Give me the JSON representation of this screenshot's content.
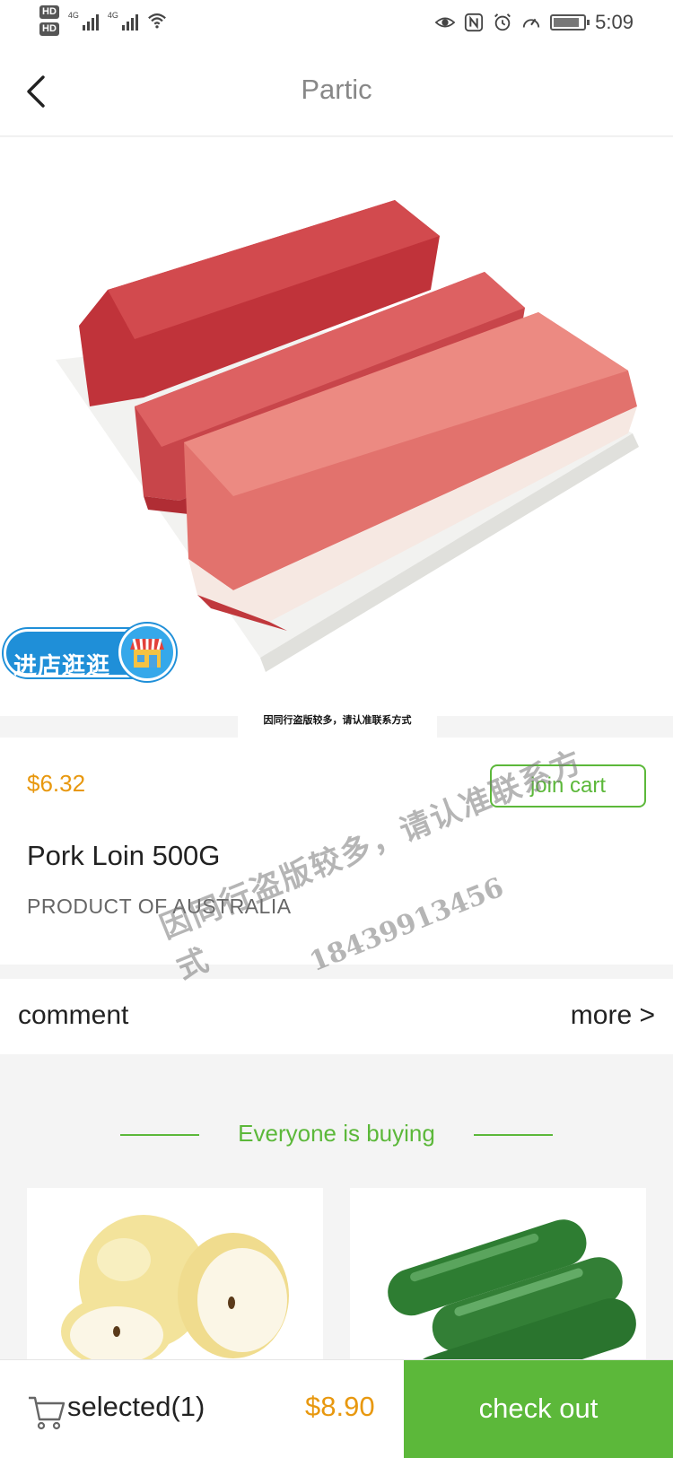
{
  "status_bar": {
    "hd1": "HD",
    "hd2": "HD",
    "net1": "4G",
    "net2": "4G",
    "time": "5:09",
    "icons": [
      "eye-icon",
      "nfc-icon",
      "alarm-icon",
      "speedometer-icon",
      "battery-icon"
    ]
  },
  "nav": {
    "title": "Partic",
    "back_icon": "chevron-left-icon"
  },
  "hero": {
    "store_badge_text": "进店逛逛",
    "watermark_line1": "因同行盗版较多，请认准联系方式",
    "watermark_line2": "18439913456"
  },
  "product": {
    "price": "$6.32",
    "join_cart_label": "join cart",
    "name": "Pork Loin 500G",
    "origin": "PRODUCT OF AUSTRALIA"
  },
  "comment": {
    "title": "comment",
    "more_label": "more >"
  },
  "recommend": {
    "heading": "Everyone is buying"
  },
  "watermark": {
    "line1": "因同行盗版较多，请认准联系方式",
    "line2": "18439913456"
  },
  "bottom_bar": {
    "selected_label": "selected(1)",
    "total": "$8.90",
    "checkout_label": "check out"
  },
  "colors": {
    "accent_green": "#5cb83a",
    "price_orange": "#e8980f",
    "store_blue": "#1f8fd8"
  }
}
